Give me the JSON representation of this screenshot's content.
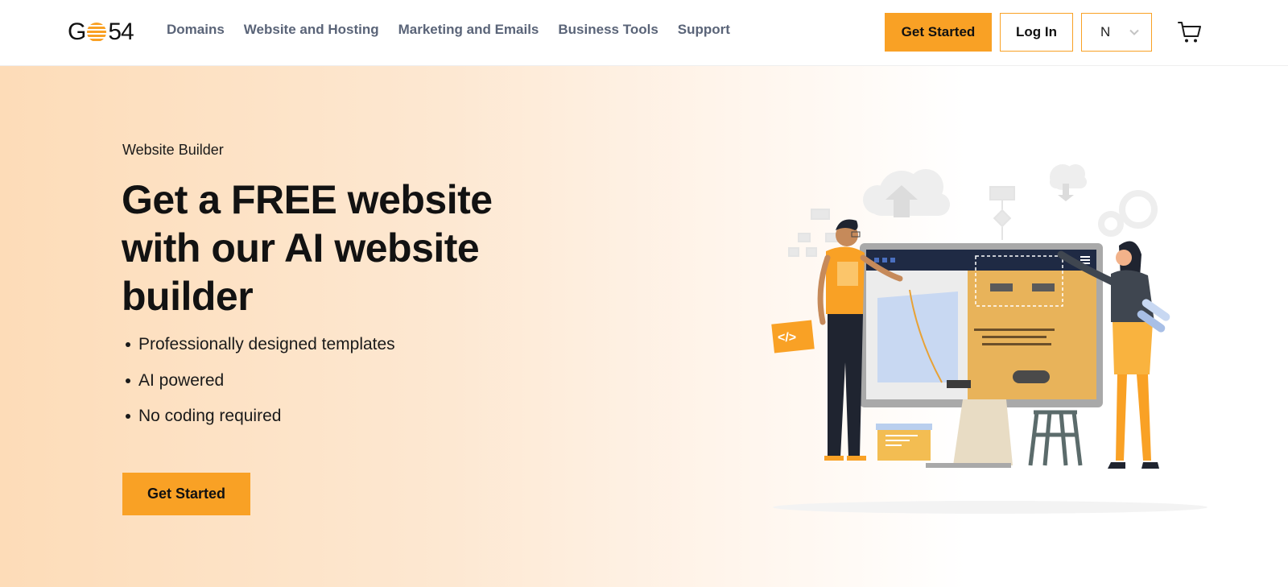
{
  "header": {
    "logo": {
      "text_left": "G",
      "text_right": "54"
    },
    "nav": [
      {
        "label": "Domains"
      },
      {
        "label": "Website and Hosting"
      },
      {
        "label": "Marketing and Emails"
      },
      {
        "label": "Business Tools"
      },
      {
        "label": "Support"
      }
    ],
    "get_started_label": "Get Started",
    "login_label": "Log In",
    "language_selected": "N",
    "icons": {
      "cart": "cart-icon",
      "chevron": "chevron-down-icon"
    }
  },
  "hero": {
    "eyebrow": "Website Builder",
    "headline_line1": "Get a FREE website",
    "headline_line2": "with our AI website",
    "headline_line3": "builder",
    "features": [
      "Professionally designed templates",
      "AI powered",
      "No coding required"
    ],
    "cta_label": "Get Started",
    "illustration_code_badge": "</>"
  },
  "colors": {
    "accent": "#f9a125",
    "nav_text": "#5a6478",
    "hero_gradient_start": "#fddcb8",
    "monitor_topbar": "#1f2a44"
  }
}
